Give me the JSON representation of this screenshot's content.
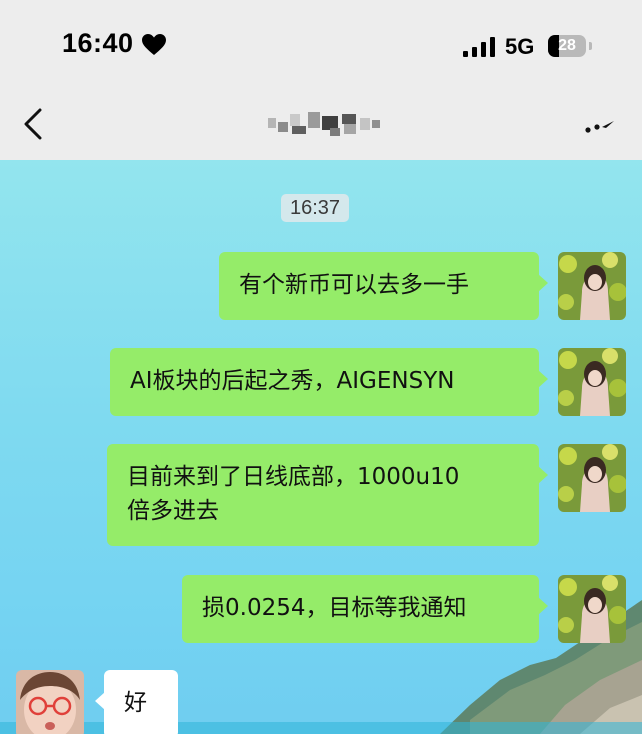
{
  "status_bar": {
    "time": "16:40",
    "status_icon": "heart-icon",
    "signal_icon": "signal-bars-icon",
    "network": "5G",
    "battery_level": "28",
    "battery_fraction": 0.28
  },
  "nav": {
    "back_icon": "chevron-left-icon",
    "contact_name": "",
    "contact_name_obscured": true,
    "more_icon": "more-icon"
  },
  "chat": {
    "timestamp": "16:37",
    "messages": [
      {
        "direction": "outgoing",
        "text": "有个新币可以去多一手"
      },
      {
        "direction": "outgoing",
        "text": "AI板块的后起之秀，AIGENSYN"
      },
      {
        "direction": "outgoing",
        "text": "目前来到了日线底部，1000u10\n倍多进去"
      },
      {
        "direction": "outgoing",
        "text": "损0.0254，目标等我通知"
      },
      {
        "direction": "incoming",
        "text": "好"
      }
    ]
  },
  "colors": {
    "header_bg": "#ededed",
    "outgoing_bubble": "#95ec69",
    "incoming_bubble": "#ffffff",
    "chat_wallpaper": "#7fdaf0"
  }
}
